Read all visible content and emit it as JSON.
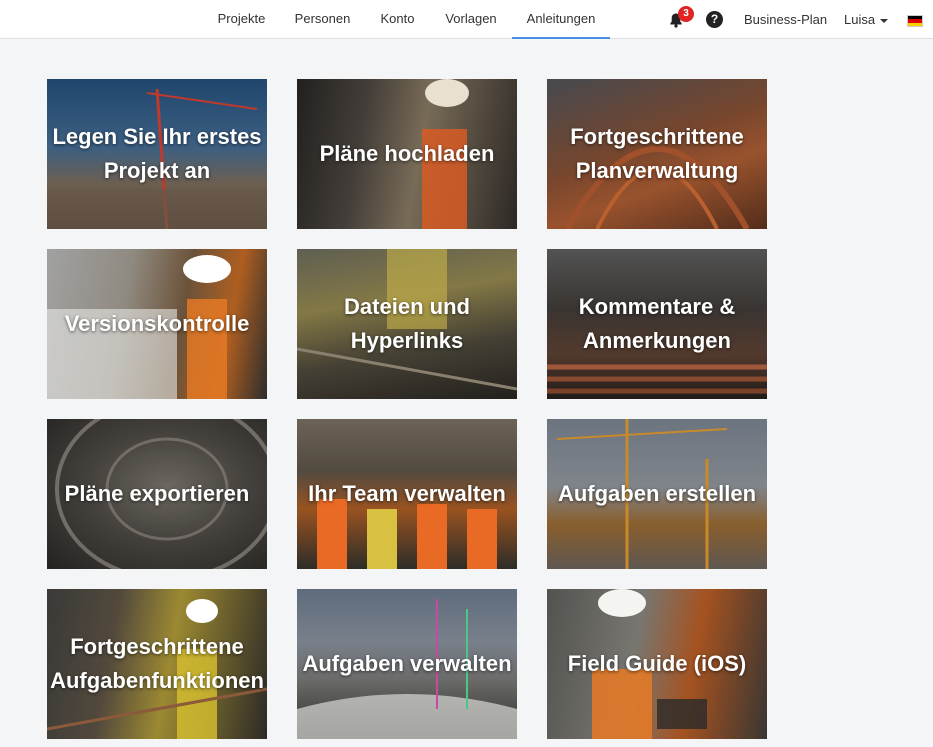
{
  "nav": {
    "items": [
      {
        "label": "Projekte"
      },
      {
        "label": "Personen"
      },
      {
        "label": "Konto"
      },
      {
        "label": "Vorlagen"
      },
      {
        "label": "Anleitungen"
      }
    ],
    "active": "Anleitungen",
    "notification_count": "3",
    "help_symbol": "?",
    "plan_label": "Business-Plan",
    "user_label": "Luisa",
    "icons": {
      "notifications": "bell-icon",
      "help": "question-circle-icon",
      "user_menu": "caret-down-icon",
      "language": "flag-de-icon"
    },
    "flag_colors": [
      "#000000",
      "#dd0000",
      "#ffce00"
    ],
    "accent_color": "#4a90e2",
    "badge_color": "#e02424"
  },
  "tiles": [
    {
      "label": "Legen Sie Ihr erstes Projekt an"
    },
    {
      "label": "Pläne hochladen"
    },
    {
      "label": "Fortgeschrittene Planverwaltung"
    },
    {
      "label": "Versionskontrolle"
    },
    {
      "label": "Dateien und Hyperlinks"
    },
    {
      "label": "Kommentare & Anmerkungen"
    },
    {
      "label": "Pläne exportieren"
    },
    {
      "label": "Ihr Team verwalten"
    },
    {
      "label": "Aufgaben erstellen"
    },
    {
      "label": "Fortgeschrittene Aufgabenfunktionen"
    },
    {
      "label": "Aufgaben verwalten"
    },
    {
      "label": "Field Guide (iOS)"
    }
  ]
}
